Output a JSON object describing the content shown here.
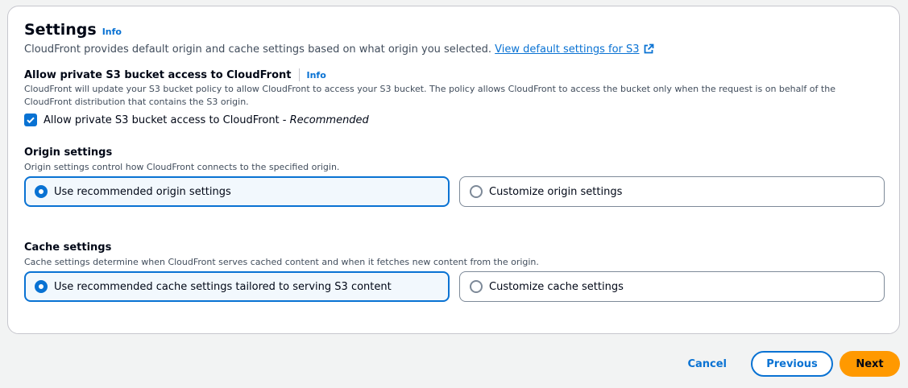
{
  "settings": {
    "title": "Settings",
    "info": "Info",
    "description": "CloudFront provides default origin and cache settings based on what origin you selected.",
    "view_link": "View default settings for S3",
    "colors": {
      "accent": "#0972d3",
      "primary_button": "#ff9900"
    }
  },
  "s3_access": {
    "title": "Allow private S3 bucket access to CloudFront",
    "info": "Info",
    "description": "CloudFront will update your S3 bucket policy to allow CloudFront to access your S3 bucket. The policy allows CloudFront to access the bucket only when the request is on behalf of the CloudFront distribution that contains the S3 origin.",
    "checkbox_label": "Allow private S3 bucket access to CloudFront - ",
    "checkbox_suffix": "Recommended",
    "checked": true
  },
  "origin": {
    "title": "Origin settings",
    "description": "Origin settings control how CloudFront connects to the specified origin.",
    "options": [
      {
        "label": "Use recommended origin settings",
        "selected": true
      },
      {
        "label": "Customize origin settings",
        "selected": false
      }
    ]
  },
  "cache": {
    "title": "Cache settings",
    "description": "Cache settings determine when CloudFront serves cached content and when it fetches new content from the origin.",
    "options": [
      {
        "label": "Use recommended cache settings tailored to serving S3 content",
        "selected": true
      },
      {
        "label": "Customize cache settings",
        "selected": false
      }
    ]
  },
  "footer": {
    "cancel": "Cancel",
    "previous": "Previous",
    "next": "Next"
  },
  "icons": {
    "external": "external-link-icon",
    "check": "checkmark-icon"
  }
}
